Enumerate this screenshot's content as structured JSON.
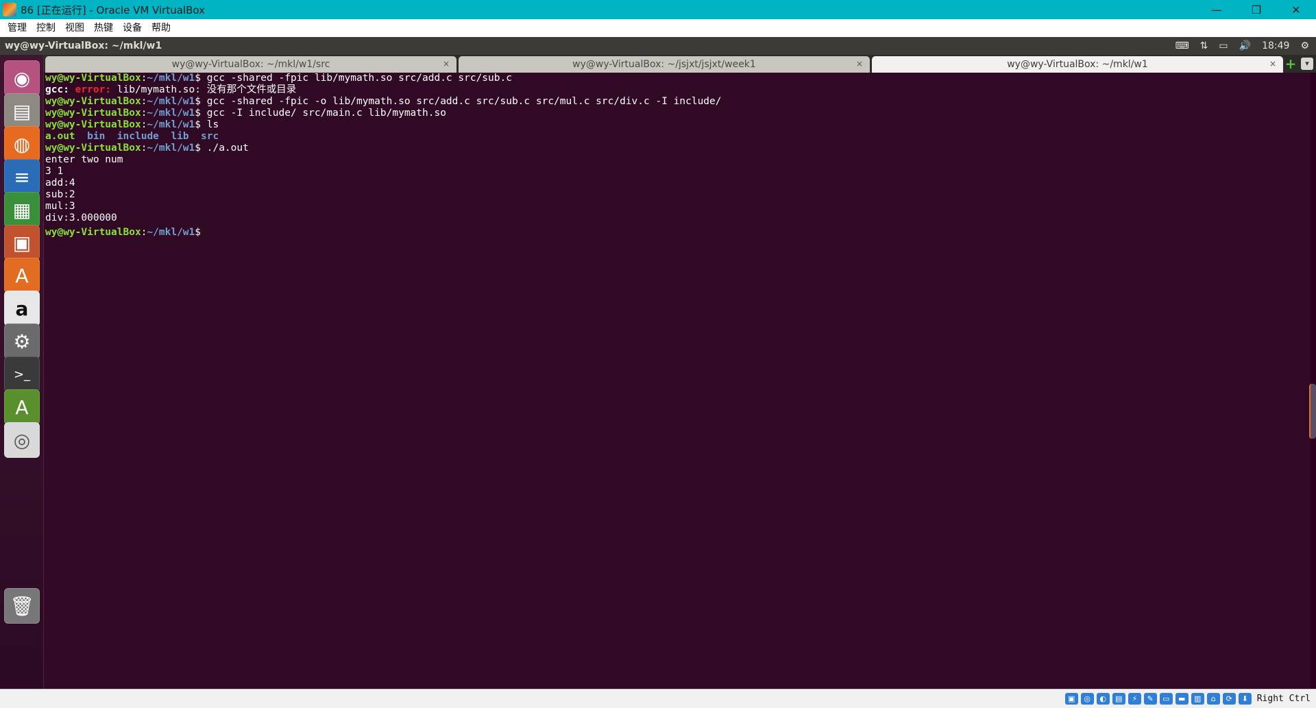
{
  "host_window": {
    "title": "86 [正在运行] - Oracle VM VirtualBox",
    "controls": {
      "minimize": "—",
      "restore": "❐",
      "close": "✕"
    },
    "menu": [
      "管理",
      "控制",
      "视图",
      "热键",
      "设备",
      "帮助"
    ],
    "status_bar": {
      "host_key": "Right Ctrl",
      "icons": [
        "hard-disk-icon",
        "optical-drive-icon",
        "audio-icon",
        "network-icon",
        "usb-icon",
        "shared-folder-icon",
        "display-icon",
        "video-capture-icon",
        "mouse-integration-icon",
        "keyboard-icon",
        "info-icon",
        "download-icon"
      ]
    }
  },
  "guest_panel": {
    "window_title": "wy@wy-VirtualBox: ~/mkl/w1",
    "time": "18:49",
    "tray_icons": [
      "keyboard-icon",
      "network-arrows-icon",
      "battery-icon",
      "volume-icon",
      "gear-icon"
    ]
  },
  "launcher": [
    {
      "name": "ubuntu-dash-icon",
      "glyph": "◉",
      "color": "#b5527f"
    },
    {
      "name": "files-icon",
      "glyph": "▤",
      "color": "#8e8a83"
    },
    {
      "name": "firefox-icon",
      "glyph": "◍",
      "color": "#e66a1f"
    },
    {
      "name": "writer-icon",
      "glyph": "≡",
      "color": "#2a6db6"
    },
    {
      "name": "calc-icon",
      "glyph": "▦",
      "color": "#3a8f3a"
    },
    {
      "name": "impress-icon",
      "glyph": "▣",
      "color": "#c0522d"
    },
    {
      "name": "software-center-icon",
      "glyph": "A",
      "color": "#e36c23"
    },
    {
      "name": "amazon-icon",
      "glyph": "a",
      "color": "#e7e7e7"
    },
    {
      "name": "system-settings-icon",
      "glyph": "⚙",
      "color": "#6b6b6b"
    },
    {
      "name": "terminal-icon",
      "glyph": ">_",
      "color": "#3a3a3a"
    },
    {
      "name": "software-updater-icon",
      "glyph": "A",
      "color": "#5a8f2e"
    },
    {
      "name": "optical-disc-icon",
      "glyph": "◎",
      "color": "#d9d9d9"
    },
    {
      "name": "trash-icon",
      "glyph": "🗑",
      "color": "#777777"
    }
  ],
  "terminal": {
    "tabs": [
      {
        "label": "wy@wy-VirtualBox: ~/mkl/w1/src",
        "active": false
      },
      {
        "label": "wy@wy-VirtualBox: ~/jsjxt/jsjxt/week1",
        "active": false
      },
      {
        "label": "wy@wy-VirtualBox: ~/mkl/w1",
        "active": true
      }
    ],
    "tab_close_glyph": "×",
    "new_tab_glyph": "+",
    "tab_menu_glyph": "▾",
    "prompt_user": "wy@wy-VirtualBox",
    "prompt_path": "~/mkl/w1",
    "lines": [
      {
        "type": "cmd",
        "text": "gcc -shared -fpic lib/mymath.so src/add.c src/sub.c"
      },
      {
        "type": "error",
        "prefix": "gcc: ",
        "label": "error: ",
        "text": "lib/mymath.so: 没有那个文件或目录"
      },
      {
        "type": "cmd",
        "text": "gcc -shared -fpic -o lib/mymath.so src/add.c src/sub.c src/mul.c src/div.c -I include/"
      },
      {
        "type": "cmd",
        "text": "gcc -I include/ src/main.c lib/mymath.so"
      },
      {
        "type": "cmd",
        "text": "ls"
      },
      {
        "type": "ls",
        "entries": [
          {
            "name": "a.out",
            "kind": "exe"
          },
          {
            "name": "bin",
            "kind": "dir"
          },
          {
            "name": "include",
            "kind": "dir"
          },
          {
            "name": "lib",
            "kind": "dir"
          },
          {
            "name": "src",
            "kind": "dir"
          }
        ]
      },
      {
        "type": "cmd",
        "text": "./a.out"
      },
      {
        "type": "out",
        "text": "enter two num"
      },
      {
        "type": "out",
        "text": "3 1"
      },
      {
        "type": "out",
        "text": "add:4"
      },
      {
        "type": "out",
        "text": "sub:2"
      },
      {
        "type": "out",
        "text": "mul:3"
      },
      {
        "type": "out",
        "text": "div:3.000000"
      },
      {
        "type": "cmd",
        "text": ""
      }
    ]
  }
}
